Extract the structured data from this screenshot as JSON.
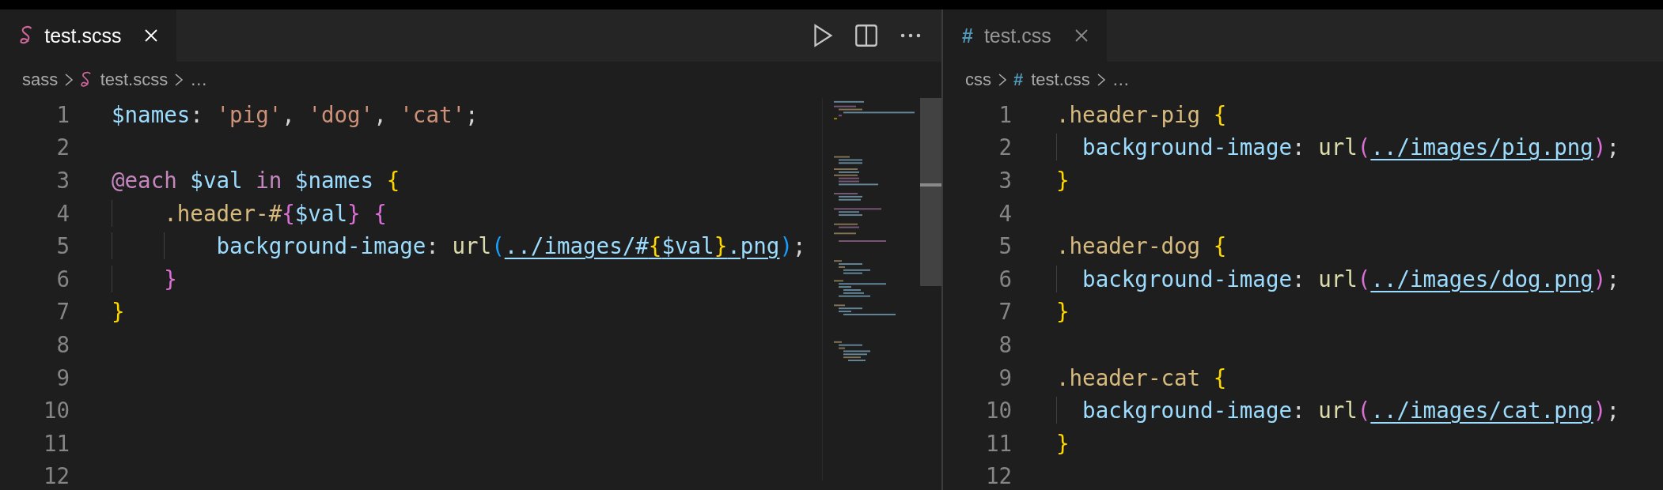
{
  "editors": [
    {
      "focused": true,
      "minimap": true,
      "tab": {
        "label": "test.scss",
        "selected": true
      },
      "actions": [
        {
          "kind": "run"
        },
        {
          "kind": "split"
        },
        {
          "kind": "more"
        }
      ],
      "breadcrumb": [
        {
          "text": "sass",
          "kind": "folder"
        },
        {
          "text": "test.scss",
          "kind": "file"
        },
        {
          "text": "…",
          "kind": "more"
        }
      ],
      "lines": [
        {
          "number": "1",
          "tokens": [
            {
              "text": "$names",
              "kind": "variable"
            },
            {
              "text": ": ",
              "kind": "punct"
            },
            {
              "text": "'pig'",
              "kind": "string"
            },
            {
              "text": ", ",
              "kind": "punct"
            },
            {
              "text": "'dog'",
              "kind": "string"
            },
            {
              "text": ", ",
              "kind": "punct"
            },
            {
              "text": "'cat'",
              "kind": "string"
            },
            {
              "text": ";",
              "kind": "punct"
            }
          ]
        },
        {
          "number": "2"
        },
        {
          "number": "3",
          "tokens": [
            {
              "text": "@each",
              "kind": "keyword"
            },
            {
              "text": " $val",
              "kind": "variable"
            },
            {
              "text": " in",
              "kind": "keyword"
            },
            {
              "text": " $names ",
              "kind": "variable"
            },
            {
              "text": "{",
              "kind": "bracket1"
            }
          ]
        },
        {
          "number": "4",
          "tokens": [
            {
              "text": "    .header-#",
              "kind": "selector"
            },
            {
              "text": "{",
              "kind": "bracket2"
            },
            {
              "text": "$val",
              "kind": "variable"
            },
            {
              "text": "}",
              "kind": "bracket2"
            },
            {
              "text": " {",
              "kind": "bracket2"
            }
          ]
        },
        {
          "number": "5",
          "tokens": [
            {
              "text": "        background-image",
              "kind": "property"
            },
            {
              "text": ": ",
              "kind": "punct"
            },
            {
              "text": "url",
              "kind": "function"
            },
            {
              "text": "(",
              "kind": "bracket3"
            },
            {
              "text": "../images/#",
              "kind": "variable",
              "link": true
            },
            {
              "text": "{",
              "kind": "bracket1",
              "link": true
            },
            {
              "text": "$val",
              "kind": "variable",
              "link": true
            },
            {
              "text": "}",
              "kind": "bracket1",
              "link": true
            },
            {
              "text": ".png",
              "kind": "variable",
              "link": true
            },
            {
              "text": ")",
              "kind": "bracket3"
            },
            {
              "text": ";",
              "kind": "punct"
            }
          ]
        },
        {
          "number": "6",
          "tokens": [
            {
              "text": "    }",
              "kind": "bracket2"
            }
          ]
        },
        {
          "number": "7",
          "tokens": [
            {
              "text": "}",
              "kind": "bracket1"
            }
          ]
        },
        {
          "number": "8"
        },
        {
          "number": "9"
        },
        {
          "number": "10"
        },
        {
          "number": "11"
        },
        {
          "number": "12"
        }
      ]
    },
    {
      "focused": false,
      "minimap": false,
      "tab": {
        "label": "test.css",
        "icon_text": "#",
        "selected": true
      },
      "breadcrumb": [
        {
          "text": "css",
          "kind": "folder"
        },
        {
          "text": "test.css",
          "kind": "file",
          "icon_text": "#"
        },
        {
          "text": "…",
          "kind": "more"
        }
      ],
      "lines": [
        {
          "number": "1",
          "tokens": [
            {
              "text": ".header-pig ",
              "kind": "selector"
            },
            {
              "text": "{",
              "kind": "bracket1"
            }
          ]
        },
        {
          "number": "2",
          "tokens": [
            {
              "text": "  background-image",
              "kind": "property"
            },
            {
              "text": ": ",
              "kind": "punct"
            },
            {
              "text": "url",
              "kind": "function"
            },
            {
              "text": "(",
              "kind": "bracket2"
            },
            {
              "text": "../images/pig.png",
              "kind": "variable",
              "link": true
            },
            {
              "text": ")",
              "kind": "bracket2"
            },
            {
              "text": ";",
              "kind": "punct"
            }
          ]
        },
        {
          "number": "3",
          "tokens": [
            {
              "text": "}",
              "kind": "bracket1"
            }
          ]
        },
        {
          "number": "4"
        },
        {
          "number": "5",
          "tokens": [
            {
              "text": ".header-dog ",
              "kind": "selector"
            },
            {
              "text": "{",
              "kind": "bracket1"
            }
          ]
        },
        {
          "number": "6",
          "tokens": [
            {
              "text": "  background-image",
              "kind": "property"
            },
            {
              "text": ": ",
              "kind": "punct"
            },
            {
              "text": "url",
              "kind": "function"
            },
            {
              "text": "(",
              "kind": "bracket2"
            },
            {
              "text": "../images/dog.png",
              "kind": "variable",
              "link": true
            },
            {
              "text": ")",
              "kind": "bracket2"
            },
            {
              "text": ";",
              "kind": "punct"
            }
          ]
        },
        {
          "number": "7",
          "tokens": [
            {
              "text": "}",
              "kind": "bracket1"
            }
          ]
        },
        {
          "number": "8"
        },
        {
          "number": "9",
          "tokens": [
            {
              "text": ".header-cat ",
              "kind": "selector"
            },
            {
              "text": "{",
              "kind": "bracket1"
            }
          ]
        },
        {
          "number": "10",
          "tokens": [
            {
              "text": "  background-image",
              "kind": "property"
            },
            {
              "text": ": ",
              "kind": "punct"
            },
            {
              "text": "url",
              "kind": "function"
            },
            {
              "text": "(",
              "kind": "bracket2"
            },
            {
              "text": "../images/cat.png",
              "kind": "variable",
              "link": true
            },
            {
              "text": ")",
              "kind": "bracket2"
            },
            {
              "text": ";",
              "kind": "punct"
            }
          ]
        },
        {
          "number": "11",
          "tokens": [
            {
              "text": "}",
              "kind": "bracket1"
            }
          ]
        },
        {
          "number": "12"
        }
      ]
    }
  ]
}
